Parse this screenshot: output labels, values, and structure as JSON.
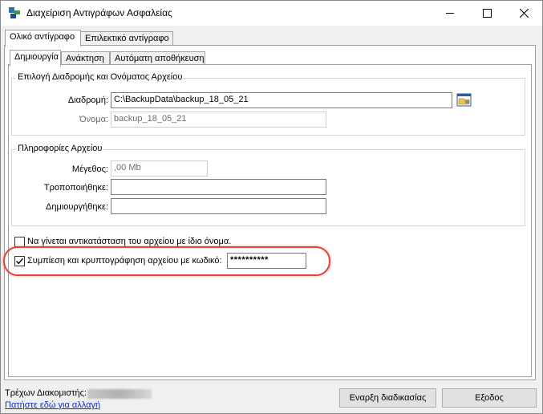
{
  "window": {
    "title": "Διαχείριση Αντιγράφων Ασφαλείας",
    "icon": "app-blocks-icon",
    "controls": [
      "minimize-icon",
      "maximize-icon",
      "close-icon"
    ]
  },
  "tabs": [
    {
      "label": "Ολικό αντίγραφο",
      "active": true
    },
    {
      "label": "Επιλεκτικό αντίγραφο",
      "active": false
    }
  ],
  "subtabs": [
    {
      "label": "Δημιουργία",
      "active": true
    },
    {
      "label": "Ανάκτηση",
      "active": false
    },
    {
      "label": "Αυτόματη αποθήκευση",
      "active": false
    }
  ],
  "path_group": {
    "title": "Επιλογή Διαδρομής και Ονόματος Αρχείου",
    "path_label": "Διαδρομή:",
    "path_value": "C:\\BackupData\\backup_18_05_21",
    "browse_icon": "folder-browse-icon",
    "name_label": "Όνομα:",
    "name_value": "backup_18_05_21"
  },
  "info_group": {
    "title": "Πληροφορίες Αρχείου",
    "size_label": "Μέγεθος:",
    "size_value": ",00 Mb",
    "modified_label": "Τροποποιήθηκε:",
    "modified_value": "",
    "created_label": "Δημιουργήθηκε:",
    "created_value": ""
  },
  "options": {
    "replace_label": "Να γίνεται αντικατάσταση του αρχείου με ίδιο όνομα.",
    "replace_checked": false,
    "compress_label": "Συμπίεση και κρυπτογράφηση αρχείου με κωδικό:",
    "compress_checked": true,
    "password_value": "**********"
  },
  "footer": {
    "server_label": "Τρέχων Διακομιστής:",
    "change_link": "Πατήστε εδώ για αλλαγή",
    "start_button": "Εναρξη διαδικασίας",
    "exit_button": "Εξοδος"
  },
  "colors": {
    "highlight": "#e0453c",
    "link": "#0a2cd6",
    "titlebar_bg": "#ffffff",
    "window_bg": "#f0f0f0"
  }
}
